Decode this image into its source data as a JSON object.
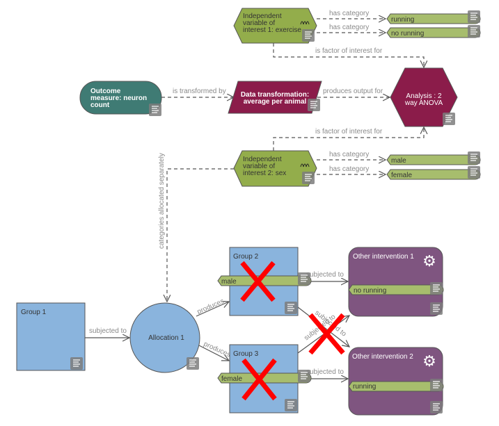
{
  "nodes": {
    "iv1": {
      "lines": [
        "Independent",
        "variable of",
        "interest 1: exercise"
      ]
    },
    "iv2": {
      "lines": [
        "Independent",
        "variable of",
        "interest 2: sex"
      ]
    },
    "running": "running",
    "no_running": "no running",
    "male": "male",
    "female": "female",
    "outcome": {
      "lines": [
        "Outcome",
        "measure: neuron",
        "count"
      ]
    },
    "transform": {
      "lines": [
        "Data transformation:",
        "average per animal"
      ]
    },
    "analysis": {
      "lines": [
        "Analysis : 2",
        "way ANOVA"
      ]
    },
    "group1": "Group 1",
    "group2": "Group 2",
    "group3": "Group 3",
    "group2_tag": "male",
    "group3_tag": "female",
    "allocation": "Allocation 1",
    "intervention1": {
      "title": "Other intervention 1",
      "tag": "no running"
    },
    "intervention2": {
      "title": "Other intervention 2",
      "tag": "running"
    }
  },
  "edges": {
    "has_category": "has category",
    "is_factor": "is factor of interest for",
    "is_transformed_by": "is transformed by",
    "produces_output_for": "produces output for",
    "categories_allocated": "categories allocated separately",
    "subjected_to": "subjected to",
    "produces": "produces"
  },
  "colors": {
    "variable": "#93ad4b",
    "category": "#a7bd6d",
    "analysis": "#8b1c4a",
    "outcome": "#3f7b74",
    "group": "#8ab4dd",
    "intervention": "#7f5580",
    "invalid_mark": "#ff0000"
  },
  "icons": {
    "document": "document-icon",
    "gear": "gear-icon",
    "variable": "wave-icon",
    "invalid": "red-x-icon"
  }
}
